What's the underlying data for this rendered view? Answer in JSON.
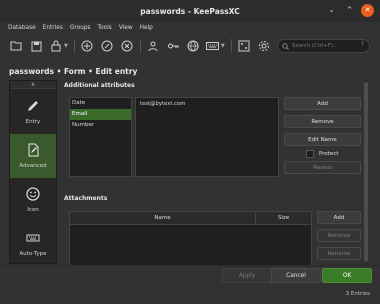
{
  "window": {
    "title": "passwords - KeePassXC"
  },
  "menu": [
    "Database",
    "Entries",
    "Groups",
    "Tools",
    "View",
    "Help"
  ],
  "toolbar": {
    "icons": [
      "open-database-icon",
      "save-database-icon",
      "lock-database-icon",
      "add-entry-icon",
      "edit-entry-icon",
      "delete-entry-icon",
      "copy-username-icon",
      "copy-password-icon",
      "copy-url-icon",
      "autotype-icon",
      "password-generator-icon",
      "settings-icon"
    ],
    "search_placeholder": "Search (Ctrl+F)...",
    "search_help": "?"
  },
  "breadcrumb": "passwords • Form • Edit entry",
  "sidebar": {
    "items": [
      {
        "label": "Entry",
        "icon": "pencil-icon",
        "active": false
      },
      {
        "label": "Advanced",
        "icon": "document-edit-icon",
        "active": true
      },
      {
        "label": "Icon",
        "icon": "smiley-icon",
        "active": false
      },
      {
        "label": "Auto-Type",
        "icon": "keyboard-icon",
        "active": false
      }
    ]
  },
  "additional_attributes": {
    "title": "Additional attributes",
    "attributes": [
      "Date",
      "Email",
      "Number"
    ],
    "selected": "Email",
    "value": "test@bytext.com",
    "buttons": {
      "add": "Add",
      "remove": "Remove",
      "edit_name": "Edit Name",
      "protect": "Protect",
      "reveal": "Reveal"
    }
  },
  "attachments": {
    "title": "Attachments",
    "columns": [
      "Name",
      "Size"
    ],
    "buttons": {
      "add": "Add",
      "remove": "Remove",
      "rename": "Rename"
    }
  },
  "footer": {
    "apply": "Apply",
    "cancel": "Cancel",
    "ok": "OK",
    "status": "3 Entries"
  },
  "colors": {
    "accent": "#3a7b27",
    "selected": "#3a6b2a",
    "close": "#e85f1f"
  }
}
